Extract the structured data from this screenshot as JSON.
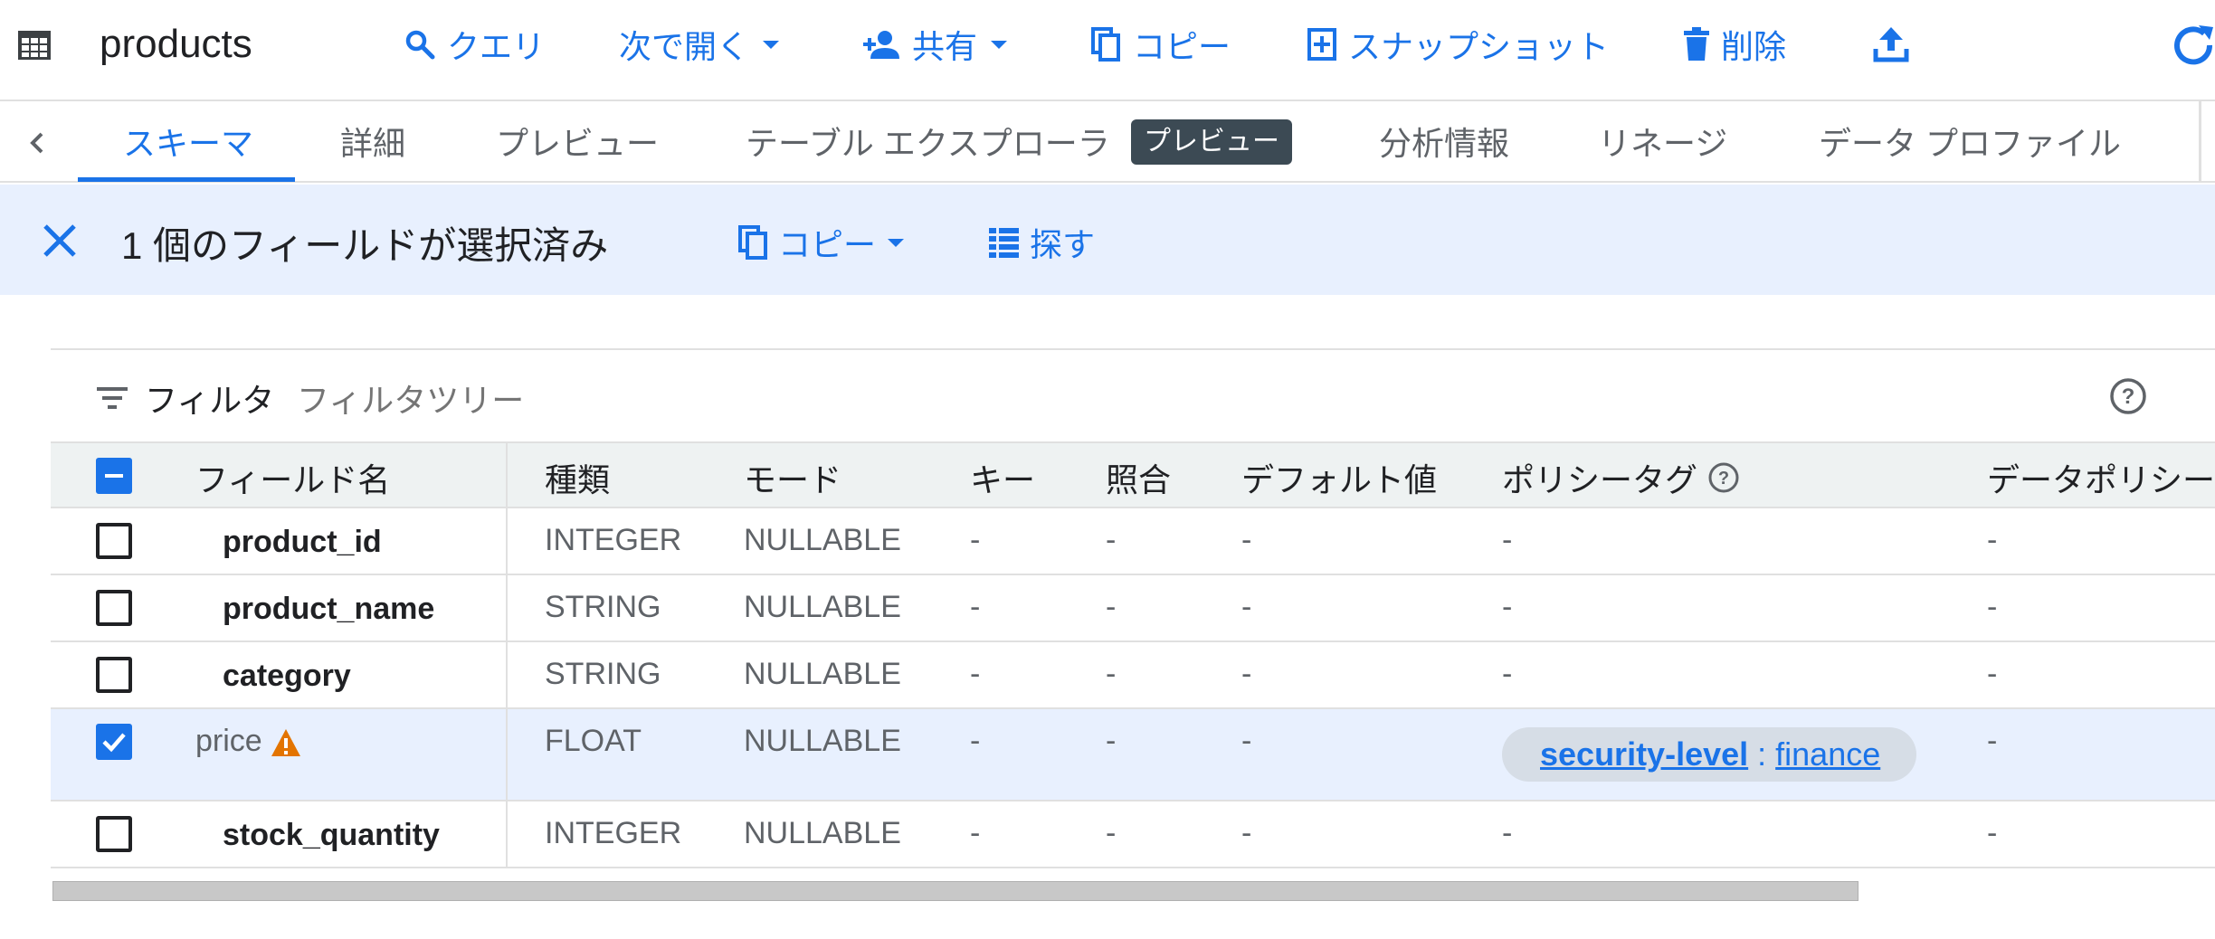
{
  "toolbar": {
    "title": "products",
    "buttons": {
      "query": "クエリ",
      "open_next": "次で開く",
      "share": "共有",
      "copy": "コピー",
      "snapshot": "スナップショット",
      "delete": "削除"
    }
  },
  "tabs": {
    "items": [
      "スキーマ",
      "詳細",
      "プレビュー",
      "テーブル エクスプローラ",
      "分析情報",
      "リネージ",
      "データ プロファイル"
    ],
    "badge": "プレビュー",
    "active_index": 0
  },
  "banner": {
    "selection_text": "1 個のフィールドが選択済み",
    "copy_label": "コピー",
    "explore_label": "探す"
  },
  "filter": {
    "label": "フィルタ",
    "placeholder": "フィルタツリー"
  },
  "table": {
    "headers": {
      "field_name": "フィールド名",
      "type": "種類",
      "mode": "モード",
      "key": "キー",
      "collation": "照合",
      "default_value": "デフォルト値",
      "policy_tag": "ポリシータグ",
      "data_policy": "データポリシー"
    },
    "rows": [
      {
        "name": "product_id",
        "type": "INTEGER",
        "mode": "NULLABLE",
        "key": "-",
        "collation": "-",
        "default": "-",
        "policy": "-",
        "data_policy": "-",
        "checked": false
      },
      {
        "name": "product_name",
        "type": "STRING",
        "mode": "NULLABLE",
        "key": "-",
        "collation": "-",
        "default": "-",
        "policy": "-",
        "data_policy": "-",
        "checked": false
      },
      {
        "name": "category",
        "type": "STRING",
        "mode": "NULLABLE",
        "key": "-",
        "collation": "-",
        "default": "-",
        "policy": "-",
        "data_policy": "-",
        "checked": false
      },
      {
        "name": "price",
        "type": "FLOAT",
        "mode": "NULLABLE",
        "key": "-",
        "collation": "-",
        "default": "-",
        "policy_tag": "security-level",
        "policy_sep": " : ",
        "policy_value": "finance",
        "data_policy": "-",
        "checked": true
      },
      {
        "name": "stock_quantity",
        "type": "INTEGER",
        "mode": "NULLABLE",
        "key": "-",
        "collation": "-",
        "default": "-",
        "policy": "-",
        "data_policy": "-",
        "checked": false
      }
    ]
  },
  "colors": {
    "accent": "#1a73e8",
    "banner_bg": "#e8f0fe",
    "header_bg": "#eef2f2",
    "badge_bg": "#3c4a54",
    "warning": "#e37400",
    "chip_bg": "#d6dde6"
  },
  "icons": [
    "table-icon",
    "search-icon",
    "dropdown-icon",
    "person-add-icon",
    "copy-icon",
    "snapshot-icon",
    "trash-icon",
    "upload-icon",
    "refresh-icon",
    "chevron-left-icon",
    "close-icon",
    "list-icon",
    "filter-icon",
    "help-icon",
    "warning-icon",
    "checkbox-icon"
  ]
}
